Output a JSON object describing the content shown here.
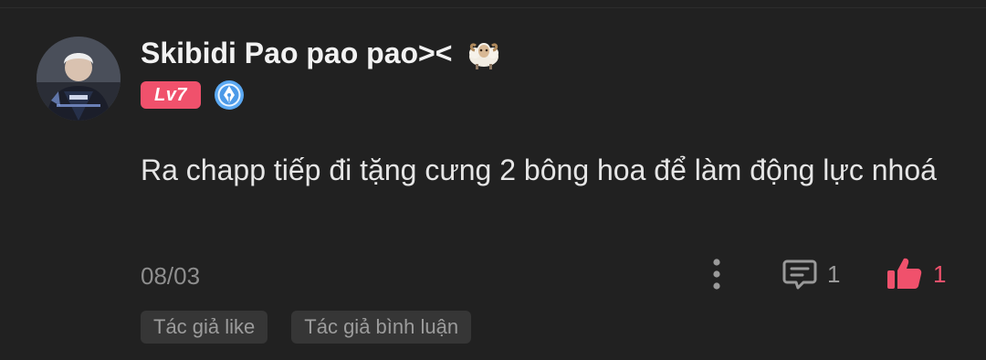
{
  "comment": {
    "author": {
      "name": "Skibidi Pao pao pao><",
      "name_icon": "sheep-icon",
      "avatar_icon": "avatar-photo",
      "level": "Lv7",
      "level_color": "#f0516c",
      "medal_icon": "pen-nib-medal-icon"
    },
    "text": "Ra chapp tiếp đi tặng cưng 2 bông hoa để làm động lực nhoá",
    "date": "08/03",
    "actions": {
      "more_icon": "more-vertical-icon",
      "reply_icon": "comment-icon",
      "reply_count": "1",
      "like_icon": "thumbs-up-icon",
      "like_count": "1",
      "like_color": "#f0516c"
    },
    "tags": [
      "Tác giả like",
      "Tác giả bình luận"
    ]
  }
}
